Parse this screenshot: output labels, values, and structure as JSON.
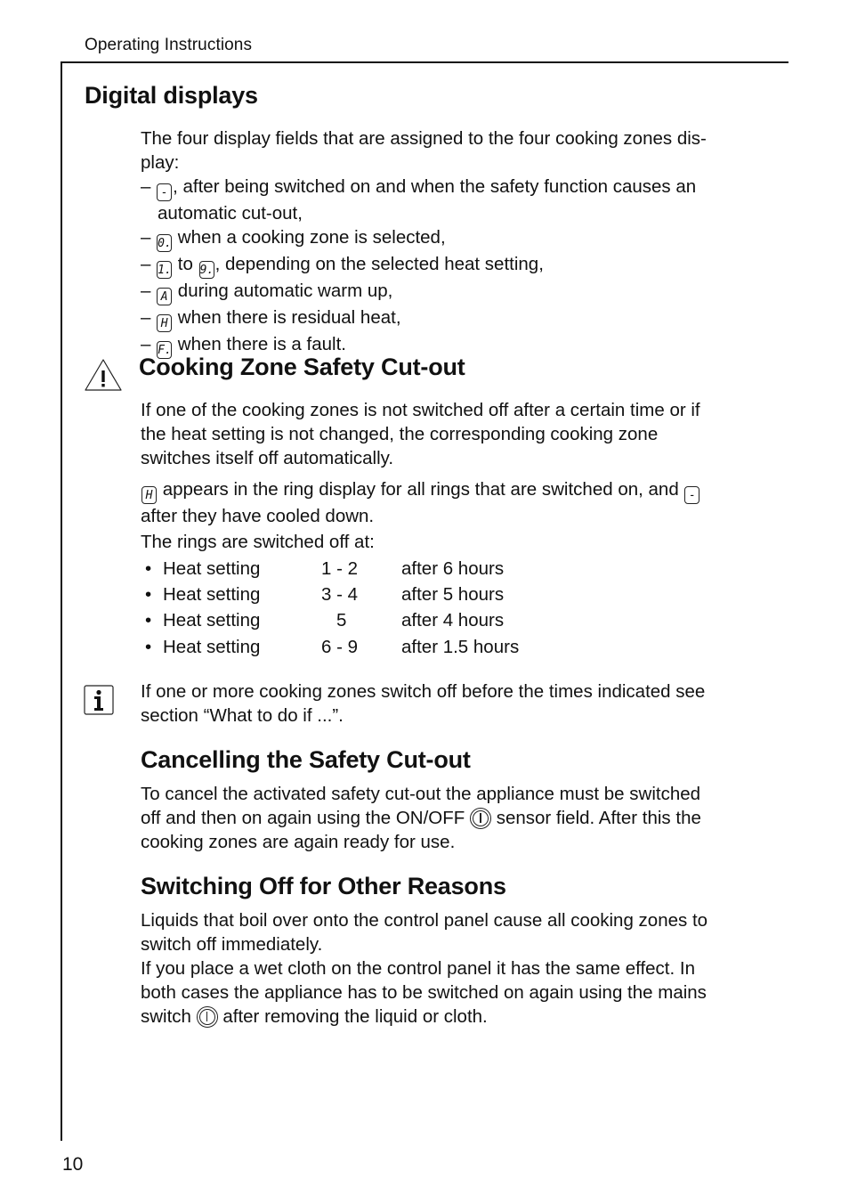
{
  "header": {
    "running_head": "Operating Instructions",
    "page_number": "10"
  },
  "digital_displays": {
    "title": "Digital displays",
    "intro_l1": "The four display fields that are assigned to the four cooking zones dis-",
    "intro_l2": "play:",
    "items": [
      {
        "dash": "–",
        "symbol": "-",
        "text": ", after being switched on and when the safety function causes an",
        "cont": "automatic cut-out,"
      },
      {
        "dash": "–",
        "symbol": "0.",
        "text": " when a cooking zone is selected,"
      },
      {
        "dash": "–",
        "symbol": "1.",
        "mid": " to ",
        "symbol2": "9.",
        "text": ", depending on the selected heat setting,"
      },
      {
        "dash": "–",
        "symbol": "A",
        "text": " during automatic warm up,"
      },
      {
        "dash": "–",
        "symbol": "H",
        "text": " when there is residual heat,"
      },
      {
        "dash": "–",
        "symbol": "F.",
        "text": " when there is a fault."
      }
    ]
  },
  "safety_cutout": {
    "title": "Cooking Zone Safety Cut-out",
    "icon": "warning-triangle-icon",
    "p1": [
      "If one of the cooking zones is not switched off after a certain time or if",
      "the heat setting is not changed, the corresponding cooking zone",
      "switches itself off automatically."
    ],
    "p2_symbol": "H",
    "p2_text": " appears in the ring display for all rings that are switched on, and ",
    "p2_symbol2": "-",
    "p2_l2": "after they have cooled down.",
    "p3": "The rings are switched off at:",
    "table": [
      {
        "bullet": "•",
        "label": "Heat setting",
        "range": "1 - 2",
        "time": "after 6 hours"
      },
      {
        "bullet": "•",
        "label": "Heat setting",
        "range": "3 - 4",
        "time": "after 5 hours"
      },
      {
        "bullet": "•",
        "label": "Heat setting",
        "range": "5",
        "time": "after 4 hours"
      },
      {
        "bullet": "•",
        "label": "Heat setting",
        "range": "6 - 9",
        "time": "after 1.5 hours"
      }
    ],
    "info_icon": "info-icon",
    "info_l1": "If one or more cooking zones switch off before the times indicated see",
    "info_l2": "section “What to do if ...”."
  },
  "cancelling": {
    "title": "Cancelling the Safety Cut-out",
    "l1": "To cancel the activated safety cut-out the appliance must be switched",
    "l2a": "off and then on again using the ON/OFF ",
    "l2b": " sensor field. After this the",
    "l3": "cooking zones are again ready for use."
  },
  "other_reasons": {
    "title": "Switching Off for Other Reasons",
    "l1": "Liquids that boil over onto the control panel cause all cooking zones to",
    "l2": "switch off immediately.",
    "l3": "If you place a wet cloth on the control panel it has the same effect. In",
    "l4": "both cases the appliance has to be switched on again using the mains",
    "l5a": "switch ",
    "l5b": " after removing the liquid or cloth."
  }
}
